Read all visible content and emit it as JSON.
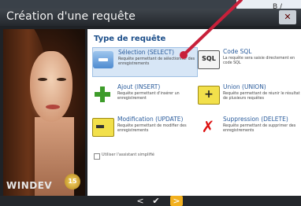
{
  "background_window": {
    "glyph": "B /"
  },
  "dialog": {
    "title": "Création d'une requête",
    "close_label": "✕",
    "brand": "WINDEV",
    "brand_badge": "15"
  },
  "panel": {
    "title": "Type de requête",
    "options": [
      {
        "id": "select",
        "label": "Sélection (SELECT)",
        "desc": "Requête permettant de sélectionner des enregistrements",
        "icon": "select-icon",
        "selected": true
      },
      {
        "id": "sql",
        "label": "Code SQL",
        "desc": "La requête sera saisie directement en code SQL",
        "icon": "sql-icon",
        "selected": false
      },
      {
        "id": "insert",
        "label": "Ajout (INSERT)",
        "desc": "Requête permettant d'insérer un enregistrement",
        "icon": "insert-icon",
        "selected": false
      },
      {
        "id": "union",
        "label": "Union (UNION)",
        "desc": "Requête permettant de réunir le résultat de plusieurs requêtes",
        "icon": "union-icon",
        "selected": false
      },
      {
        "id": "update",
        "label": "Modification (UPDATE)",
        "desc": "Requête permettant de modifier des enregistrements",
        "icon": "update-icon",
        "selected": false
      },
      {
        "id": "delete",
        "label": "Suppression (DELETE)",
        "desc": "Requête permettant de supprimer des enregistrements",
        "icon": "delete-icon",
        "selected": false
      }
    ],
    "checkbox_label": "Utiliser l'assistant simplifié",
    "checkbox_checked": false
  },
  "navigation": {
    "prev": "<",
    "ok": "✔",
    "next": ">"
  },
  "colors": {
    "accent": "#1d4f8a",
    "selected_bg": "#d7e6f6",
    "next_button": "#f2b01e",
    "annotation_arrow": "#c8203a"
  }
}
